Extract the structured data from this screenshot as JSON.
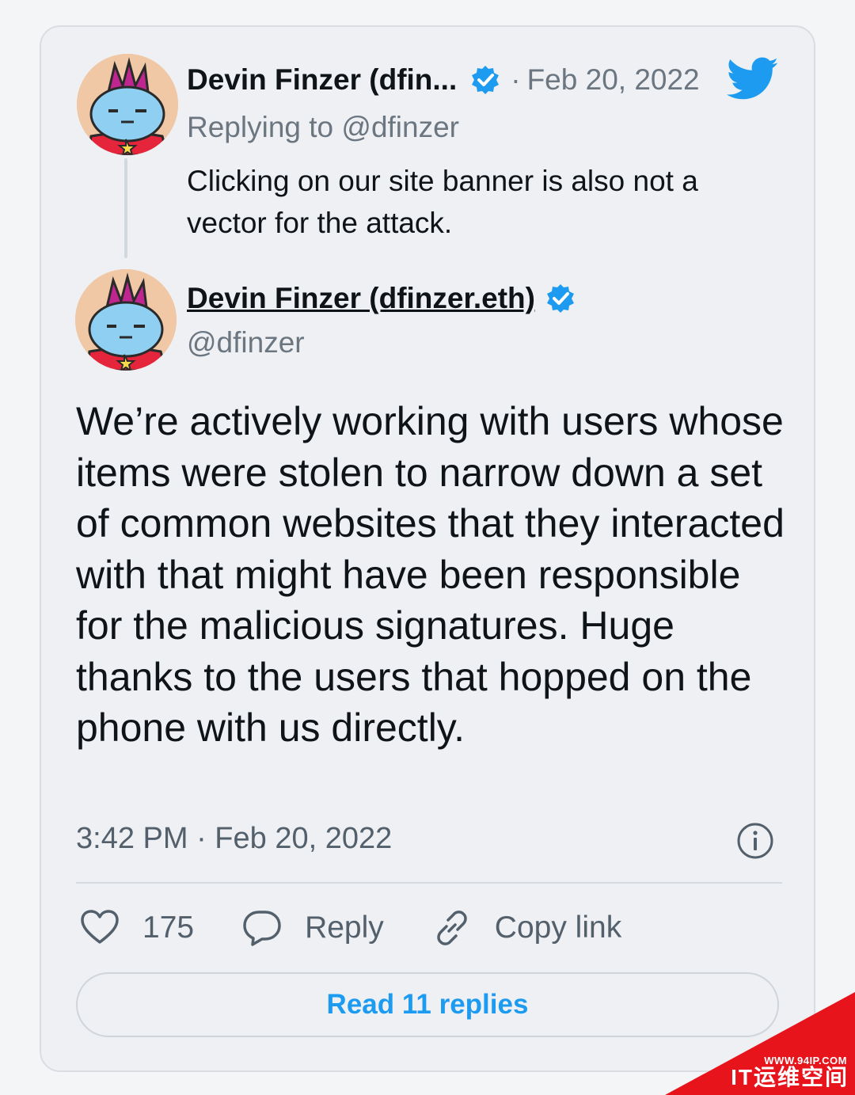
{
  "parent_tweet": {
    "author_name": "Devin Finzer (dfin...",
    "separator": "·",
    "date": "Feb 20, 2022",
    "replying_to": "Replying to @dfinzer",
    "text": "Clicking on our site banner is also not a vector for the attack."
  },
  "main_tweet": {
    "author_name": "Devin Finzer (dfinzer.eth)",
    "handle": "@dfinzer",
    "text": "We’re actively working with users whose items were stolen to narrow down a set of common websites that they interacted with that might have been responsible for the malicious signatures. Huge thanks to the users that hopped on the phone with us directly.",
    "timestamp": "3:42 PM · Feb 20, 2022"
  },
  "actions": {
    "like_count": "175",
    "reply_label": "Reply",
    "copy_label": "Copy link"
  },
  "read_replies_label": "Read 11 replies",
  "watermark": {
    "site": "WWW.94IP.COM",
    "brand": "IT运维空间"
  },
  "colors": {
    "accent": "#1d9bf0",
    "muted_text": "#6b7680",
    "card_bg": "#eef0f3",
    "watermark_red": "#e8141c"
  },
  "icons": [
    "verified-badge-icon",
    "twitter-bird-icon",
    "info-icon",
    "heart-icon",
    "reply-bubble-icon",
    "link-icon"
  ]
}
